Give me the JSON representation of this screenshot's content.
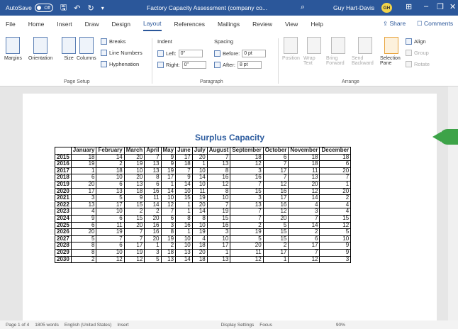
{
  "titlebar": {
    "autosave_label": "AutoSave",
    "autosave_state": "Off",
    "doc_title": "Factory Capacity Assessment (company co...",
    "user_name": "Guy Hart-Davis",
    "user_initials": "GH"
  },
  "menu": {
    "tabs": [
      "File",
      "Home",
      "Insert",
      "Draw",
      "Design",
      "Layout",
      "References",
      "Mailings",
      "Review",
      "View",
      "Help"
    ],
    "active_tab": "Layout",
    "share_label": "Share",
    "comments_label": "Comments"
  },
  "ribbon": {
    "page_setup": {
      "margins": "Margins",
      "orientation": "Orientation",
      "size": "Size",
      "columns": "Columns",
      "breaks": "Breaks",
      "line_numbers": "Line Numbers",
      "hyphenation": "Hyphenation",
      "group_label": "Page Setup"
    },
    "paragraph": {
      "indent_label": "Indent",
      "left_label": "Left:",
      "left_value": "0\"",
      "right_label": "Right:",
      "right_value": "0\"",
      "spacing_label": "Spacing",
      "before_label": "Before:",
      "before_value": "0 pt",
      "after_label": "After:",
      "after_value": "8 pt",
      "group_label": "Paragraph"
    },
    "arrange": {
      "position": "Position",
      "wrap_text": "Wrap Text",
      "bring_forward": "Bring Forward",
      "send_backward": "Send Backward",
      "selection_pane": "Selection Pane",
      "align": "Align",
      "group": "Group",
      "rotate": "Rotate",
      "group_label": "Arrange"
    }
  },
  "document": {
    "title": "Surplus Capacity",
    "months": [
      "January",
      "February",
      "March",
      "April",
      "May",
      "June",
      "July",
      "August",
      "September",
      "October",
      "November",
      "December"
    ],
    "rows": [
      {
        "year": "2015",
        "values": [
          "18",
          "14",
          "20",
          "7",
          "9",
          "17",
          "20",
          "7",
          "18",
          "6",
          "18",
          "18"
        ]
      },
      {
        "year": "2016",
        "values": [
          "19",
          "2",
          "19",
          "13",
          "9",
          "18",
          "1",
          "13",
          "12",
          "7",
          "18",
          "6"
        ]
      },
      {
        "year": "2017",
        "values": [
          "1",
          "18",
          "10",
          "13",
          "19",
          "7",
          "10",
          "8",
          "3",
          "17",
          "11",
          "20"
        ]
      },
      {
        "year": "2018",
        "values": [
          "6",
          "10",
          "20",
          "8",
          "17",
          "9",
          "14",
          "16",
          "16",
          "7",
          "13",
          "7"
        ]
      },
      {
        "year": "2019",
        "values": [
          "20",
          "6",
          "13",
          "6",
          "1",
          "14",
          "10",
          "12",
          "7",
          "12",
          "20",
          "1"
        ]
      },
      {
        "year": "2020",
        "values": [
          "17",
          "13",
          "18",
          "16",
          "14",
          "10",
          "11",
          "8",
          "15",
          "16",
          "12",
          "20"
        ]
      },
      {
        "year": "2021",
        "values": [
          "3",
          "5",
          "9",
          "11",
          "10",
          "15",
          "19",
          "10",
          "3",
          "17",
          "14",
          "2"
        ]
      },
      {
        "year": "2022",
        "values": [
          "13",
          "17",
          "15",
          "14",
          "12",
          "1",
          "20",
          "7",
          "13",
          "16",
          "4",
          "4"
        ]
      },
      {
        "year": "2023",
        "values": [
          "4",
          "10",
          "2",
          "2",
          "7",
          "1",
          "14",
          "19",
          "7",
          "12",
          "3",
          "4"
        ]
      },
      {
        "year": "2024",
        "values": [
          "9",
          "6",
          "15",
          "20",
          "6",
          "8",
          "8",
          "15",
          "7",
          "20",
          "7",
          "15"
        ]
      },
      {
        "year": "2025",
        "values": [
          "6",
          "11",
          "20",
          "16",
          "3",
          "16",
          "10",
          "16",
          "2",
          "5",
          "14",
          "12"
        ]
      },
      {
        "year": "2026",
        "values": [
          "20",
          "19",
          "7",
          "16",
          "8",
          "1",
          "19",
          "3",
          "19",
          "15",
          "2",
          "5"
        ]
      },
      {
        "year": "2027",
        "values": [
          "5",
          "7",
          "7",
          "20",
          "19",
          "10",
          "4",
          "10",
          "5",
          "15",
          "6",
          "10"
        ]
      },
      {
        "year": "2028",
        "values": [
          "8",
          "6",
          "17",
          "1",
          "2",
          "10",
          "18",
          "17",
          "20",
          "2",
          "17",
          "9"
        ]
      },
      {
        "year": "2029",
        "values": [
          "8",
          "10",
          "19",
          "3",
          "18",
          "13",
          "20",
          "1",
          "11",
          "17",
          "7",
          "9"
        ]
      },
      {
        "year": "2030",
        "values": [
          "2",
          "12",
          "12",
          "5",
          "13",
          "14",
          "18",
          "13",
          "12",
          "1",
          "12",
          "3"
        ]
      }
    ]
  },
  "statusbar": {
    "page": "Page 1 of 4",
    "words": "1805 words",
    "language": "English (United States)",
    "mode": "Insert",
    "display_settings": "Display Settings",
    "focus": "Focus",
    "zoom": "90%"
  }
}
